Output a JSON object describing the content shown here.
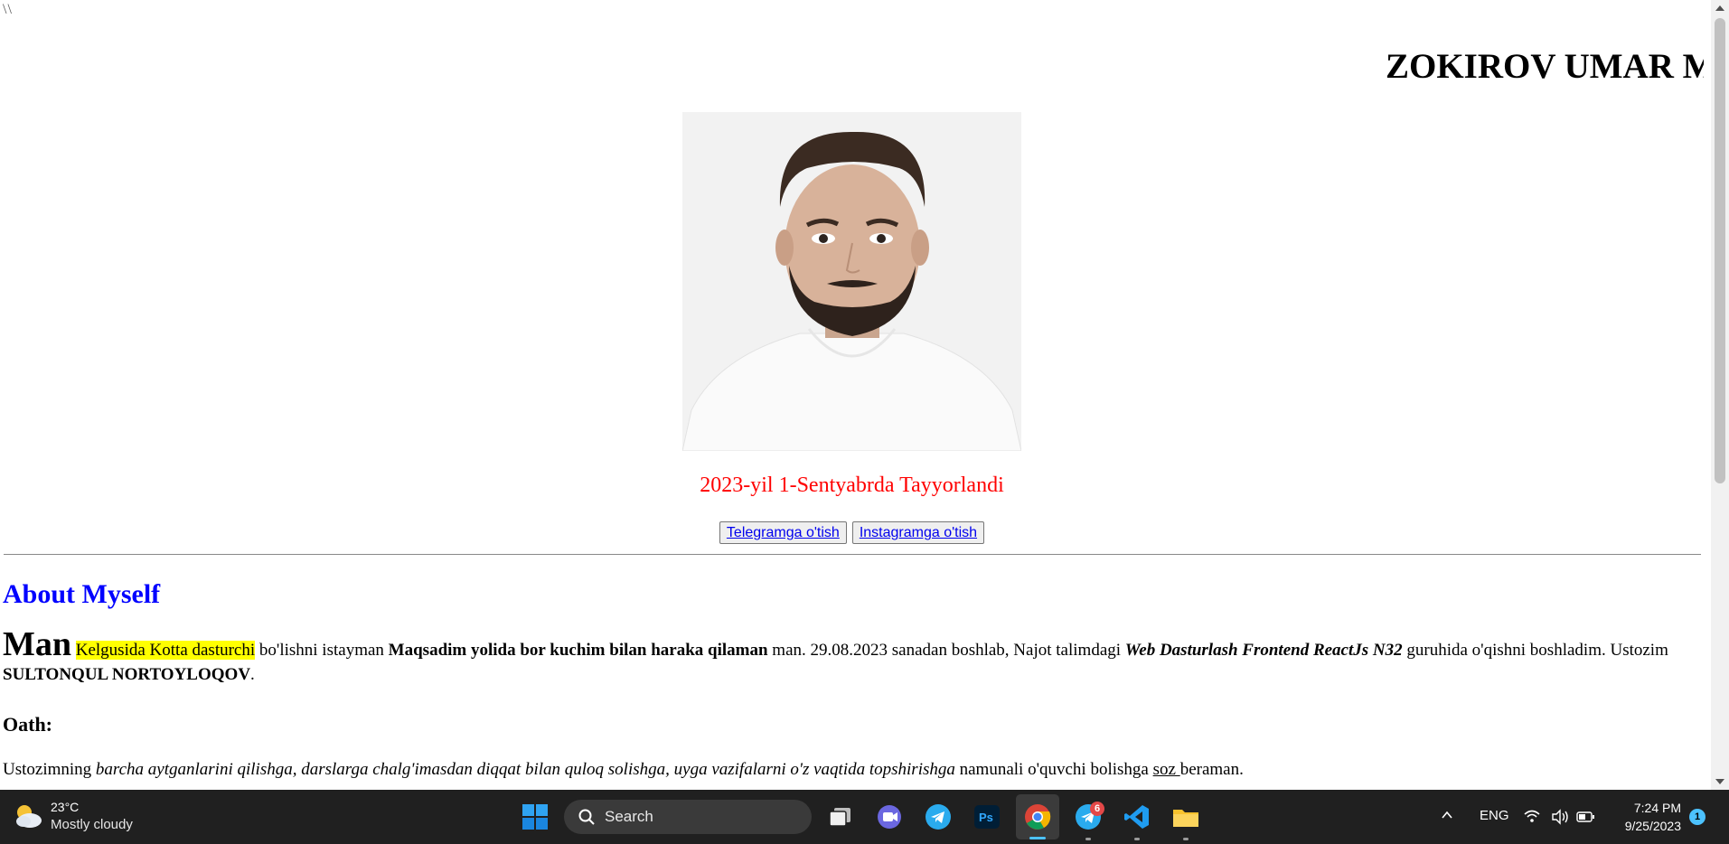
{
  "page": {
    "backslashes": "\\\\",
    "marquee_title": "ZOKIROV UMAR MUSTAFOQULOVICH",
    "photo_alt": "portrait",
    "date_line": "2023-yil 1-Sentyabrda Tayyorlandi",
    "buttons": {
      "telegram": "Telegramga o'tish",
      "instagram": "Instagramga o'tish"
    },
    "about_heading": "About Myself",
    "para1": {
      "big_word": "Man",
      "highlight": "Kelgusida Kotta dasturchi",
      "t1": " bo'lishni istayman ",
      "bold1": "Maqsadim yolida bor kuchim bilan haraka qilaman",
      "t2": " man. 29.08.2023 sanadan boshlab, Najot talimdagi ",
      "bold_italic": "Web Dasturlash Frontend ReactJs N32",
      "t3": " guruhida o'qishni boshladim. Ustozim ",
      "bold2": "SULTONQUL NORTOYLOQOV",
      "t4": "."
    },
    "oath_heading": "Oath:",
    "para2": {
      "t1": "Ustozimning ",
      "italic": "barcha aytganlarini qilishga, darslarga chalg'imasdan diqqat bilan quloq solishga, uyga vazifalarni o'z vaqtida topshirishga",
      "t2": " namunali o'quvchi bolishga ",
      "underline": "soz ",
      "t3": "beraman."
    }
  },
  "taskbar": {
    "weather_temp": "23°C",
    "weather_desc": "Mostly cloudy",
    "search_placeholder": "Search",
    "telegram_badge": "6",
    "language": "ENG",
    "time": "7:24 PM",
    "date": "9/25/2023",
    "notifications": "1",
    "colors": {
      "accent": "#4cc2ff",
      "background": "#202020"
    }
  },
  "colors": {
    "date_line": "#ff0000",
    "heading": "#0000ff",
    "highlight": "#ffff00",
    "link": "#0000ee"
  }
}
